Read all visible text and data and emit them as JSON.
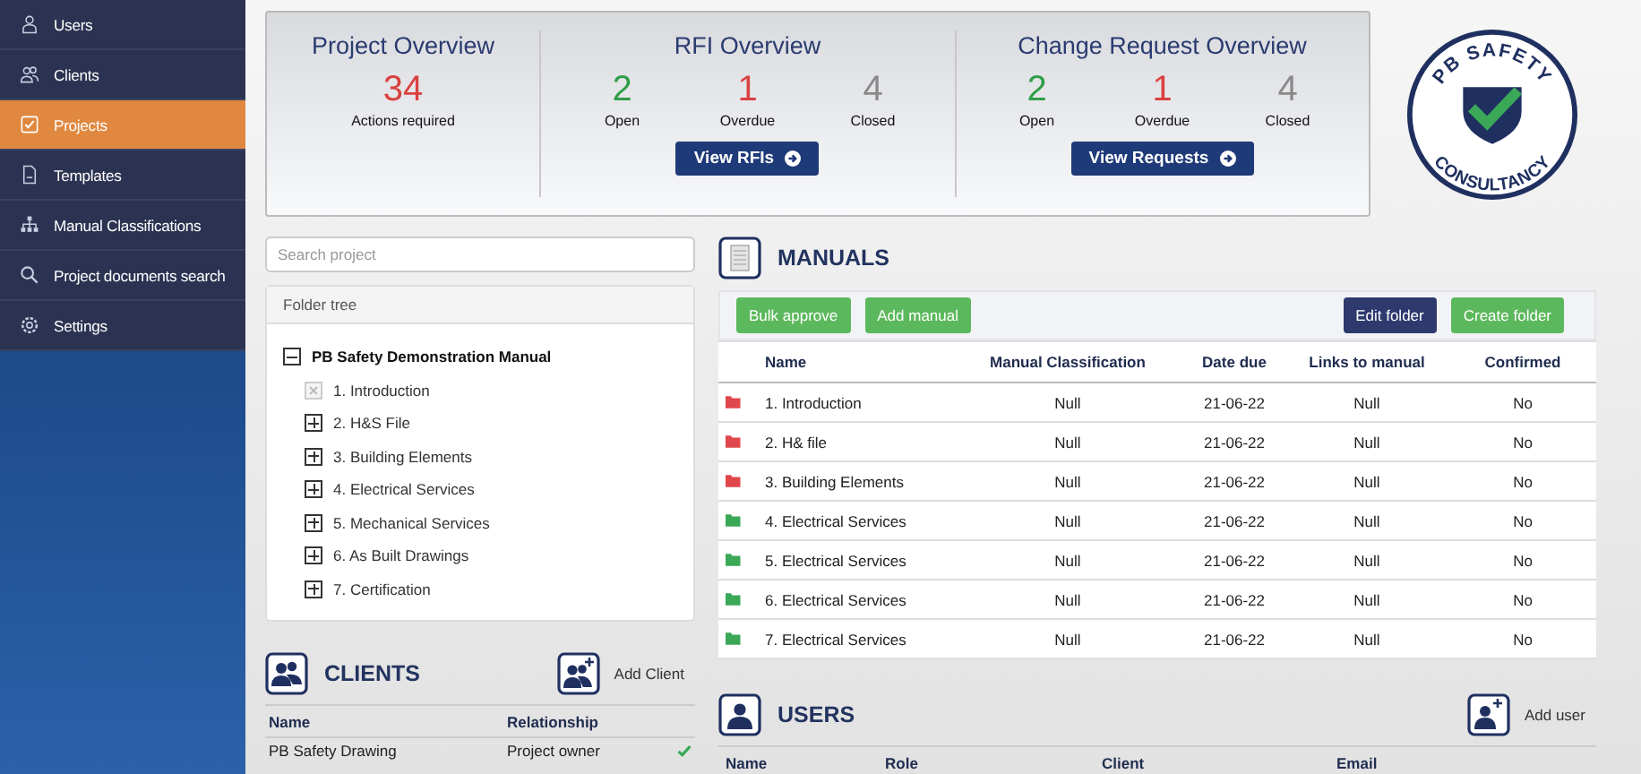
{
  "sidebar": {
    "items": [
      {
        "label": "Users",
        "selected": false
      },
      {
        "label": "Clients",
        "selected": false
      },
      {
        "label": "Projects",
        "selected": true
      },
      {
        "label": "Templates",
        "selected": false
      },
      {
        "label": "Manual Classifications",
        "selected": false
      },
      {
        "label": "Project documents search",
        "selected": false
      },
      {
        "label": "Settings",
        "selected": false
      }
    ]
  },
  "overview": {
    "project": {
      "title": "Project Overview",
      "count": "34",
      "caption": "Actions required"
    },
    "rfi": {
      "title": "RFI Overview",
      "stats": [
        {
          "kind": "open",
          "value": "2",
          "label": "Open"
        },
        {
          "kind": "overdue",
          "value": "1",
          "label": "Overdue"
        },
        {
          "kind": "closed",
          "value": "4",
          "label": "Closed"
        }
      ],
      "button": "View RFIs"
    },
    "change_requests": {
      "title": "Change Request Overview",
      "stats": [
        {
          "kind": "open",
          "value": "2",
          "label": "Open"
        },
        {
          "kind": "overdue",
          "value": "1",
          "label": "Overdue"
        },
        {
          "kind": "closed",
          "value": "4",
          "label": "Closed"
        }
      ],
      "button": "View Requests"
    }
  },
  "logo": {
    "top_text": "PB SAFETY",
    "bottom_text": "CONSULTANCY"
  },
  "search": {
    "placeholder": "Search project"
  },
  "folder_tree": {
    "title": "Folder tree",
    "root": {
      "label": "PB Safety Demonstration Manual",
      "expanded": true,
      "children": [
        {
          "label": "1. Introduction",
          "kind": "empty"
        },
        {
          "label": "2. H&S File",
          "kind": "folder"
        },
        {
          "label": "3. Building Elements",
          "kind": "folder"
        },
        {
          "label": "4. Electrical Services",
          "kind": "folder"
        },
        {
          "label": "5. Mechanical Services",
          "kind": "folder"
        },
        {
          "label": "6. As Built Drawings",
          "kind": "folder"
        },
        {
          "label": "7. Certification",
          "kind": "folder"
        }
      ]
    }
  },
  "clients": {
    "title": "CLIENTS",
    "add_label": "Add Client",
    "columns": [
      "Name",
      "Relationship"
    ],
    "rows": [
      {
        "name": "PB Safety Drawing",
        "relationship": "Project owner",
        "confirmed": true
      }
    ]
  },
  "manuals": {
    "title": "MANUALS",
    "left_buttons": [
      {
        "label": "Bulk approve",
        "kind": "success"
      },
      {
        "label": "Add manual",
        "kind": "success"
      }
    ],
    "right_buttons": [
      {
        "label": "Edit folder",
        "kind": "primary"
      },
      {
        "label": "Create folder",
        "kind": "success"
      }
    ],
    "columns": [
      "Name",
      "Manual Classification",
      "Date due",
      "Links to manual",
      "Confirmed"
    ],
    "rows": [
      {
        "color": "#e0474c",
        "name": "1. Introduction",
        "classification": "Null",
        "date_due": "21-06-22",
        "links": "Null",
        "confirmed": "No"
      },
      {
        "color": "#e0474c",
        "name": "2. H& file",
        "classification": "Null",
        "date_due": "21-06-22",
        "links": "Null",
        "confirmed": "No"
      },
      {
        "color": "#e0474c",
        "name": "3. Building Elements",
        "classification": "Null",
        "date_due": "21-06-22",
        "links": "Null",
        "confirmed": "No"
      },
      {
        "color": "#3aa857",
        "name": "4. Electrical Services",
        "classification": "Null",
        "date_due": "21-06-22",
        "links": "Null",
        "confirmed": "No"
      },
      {
        "color": "#3aa857",
        "name": "5. Electrical Services",
        "classification": "Null",
        "date_due": "21-06-22",
        "links": "Null",
        "confirmed": "No"
      },
      {
        "color": "#3aa857",
        "name": "6. Electrical Services",
        "classification": "Null",
        "date_due": "21-06-22",
        "links": "Null",
        "confirmed": "No"
      },
      {
        "color": "#3aa857",
        "name": "7. Electrical Services",
        "classification": "Null",
        "date_due": "21-06-22",
        "links": "Null",
        "confirmed": "No"
      }
    ]
  },
  "users": {
    "title": "USERS",
    "add_label": "Add user",
    "columns": [
      "Name",
      "Role",
      "Client",
      "Email"
    ]
  }
}
